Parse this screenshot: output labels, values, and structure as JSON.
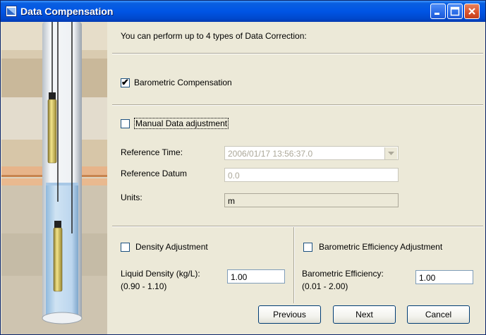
{
  "window": {
    "title": "Data Compensation"
  },
  "intro": "You can perform up to 4 types of Data Correction:",
  "barometric": {
    "label": "Barometric Compensation",
    "checked": true
  },
  "manual": {
    "label": "Manual Data adjustment",
    "checked": false,
    "reference_time_label": "Reference Time:",
    "reference_time_value": "2006/01/17 13:56:37.0",
    "reference_datum_label": "Reference Datum",
    "reference_datum_value": "0.0",
    "units_label": "Units:",
    "units_value": "m"
  },
  "density": {
    "label": "Density Adjustment",
    "checked": false,
    "field_label": "Liquid Density (kg/L):",
    "range": "(0.90 - 1.10)",
    "value": "1.00"
  },
  "baro_eff": {
    "label": "Barometric Efficiency Adjustment",
    "checked": false,
    "field_label": "Barometric Efficiency:",
    "range": "(0.01 - 2.00)",
    "value": "1.00"
  },
  "buttons": {
    "previous": "Previous",
    "next": "Next",
    "cancel": "Cancel"
  },
  "icons": [
    "app-icon",
    "minimize-icon",
    "maximize-icon",
    "close-icon",
    "checkmark-icon",
    "dropdown-arrow-icon"
  ],
  "colors": {
    "titlebar": "#0055e5",
    "close_button": "#d9502a",
    "dialog_bg": "#ece9d8"
  }
}
